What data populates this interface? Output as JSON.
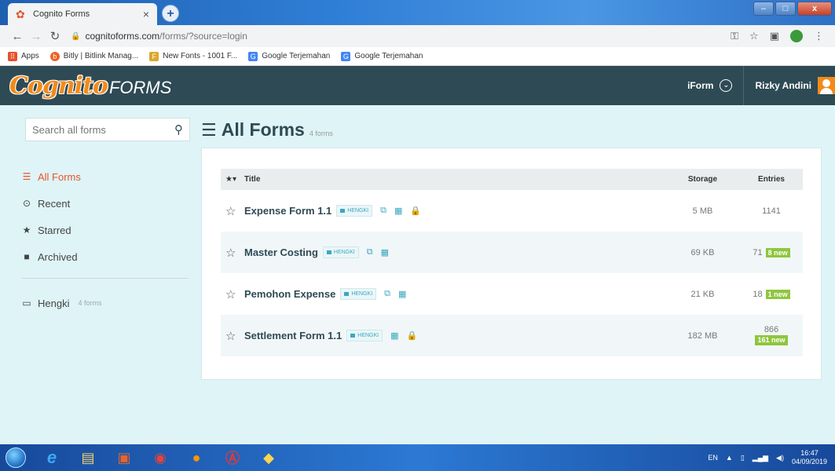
{
  "browser": {
    "tab_title": "Cognito Forms",
    "new_tab": "+",
    "url_domain": "cognitoforms.com",
    "url_path": "/forms/?source=login",
    "bookmarks": [
      {
        "label": "Apps",
        "color": "#e5532b"
      },
      {
        "label": "Bitly | Bitlink Manag...",
        "color": "#ee6123"
      },
      {
        "label": "New Fonts - 1001 F...",
        "color": "#d9a82b"
      },
      {
        "label": "Google Terjemahan",
        "color": "#4285f4"
      },
      {
        "label": "Google Terjemahan",
        "color": "#4285f4"
      }
    ]
  },
  "header": {
    "logo_main": "Cognito",
    "logo_forms": "FORMS",
    "org": "iForm",
    "user": "Rizky Andini"
  },
  "sidebar": {
    "search_placeholder": "Search all forms",
    "items": [
      {
        "label": "All Forms",
        "icon": "list-icon"
      },
      {
        "label": "Recent",
        "icon": "clock-icon"
      },
      {
        "label": "Starred",
        "icon": "star-icon"
      },
      {
        "label": "Archived",
        "icon": "archive-icon"
      }
    ],
    "folder": {
      "label": "Hengki",
      "count": "4 forms"
    }
  },
  "main": {
    "title": "All Forms",
    "count": "4 forms",
    "columns": {
      "title": "Title",
      "storage": "Storage",
      "entries": "Entries"
    },
    "forms": [
      {
        "name": "Expense Form 1.1",
        "tag": "HENGKI",
        "storage": "5 MB",
        "entries": "1141",
        "new": "",
        "locked": true
      },
      {
        "name": "Master Costing",
        "tag": "HENGKI",
        "storage": "69 KB",
        "entries": "71",
        "new": "8 new",
        "locked": false
      },
      {
        "name": "Pemohon Expense",
        "tag": "HENGKI",
        "storage": "21 KB",
        "entries": "18",
        "new": "1 new",
        "locked": false
      },
      {
        "name": "Settlement Form 1.1",
        "tag": "HENGKI",
        "storage": "182 MB",
        "entries": "866",
        "new": "161 new",
        "locked": true
      }
    ]
  },
  "taskbar": {
    "lang": "EN",
    "time": "16:47",
    "date": "04/09/2019"
  },
  "colors": {
    "accent": "#e5532b",
    "header_bg": "#2e4a55",
    "new_badge": "#8fc63e",
    "page_bg": "#dff4f7"
  }
}
